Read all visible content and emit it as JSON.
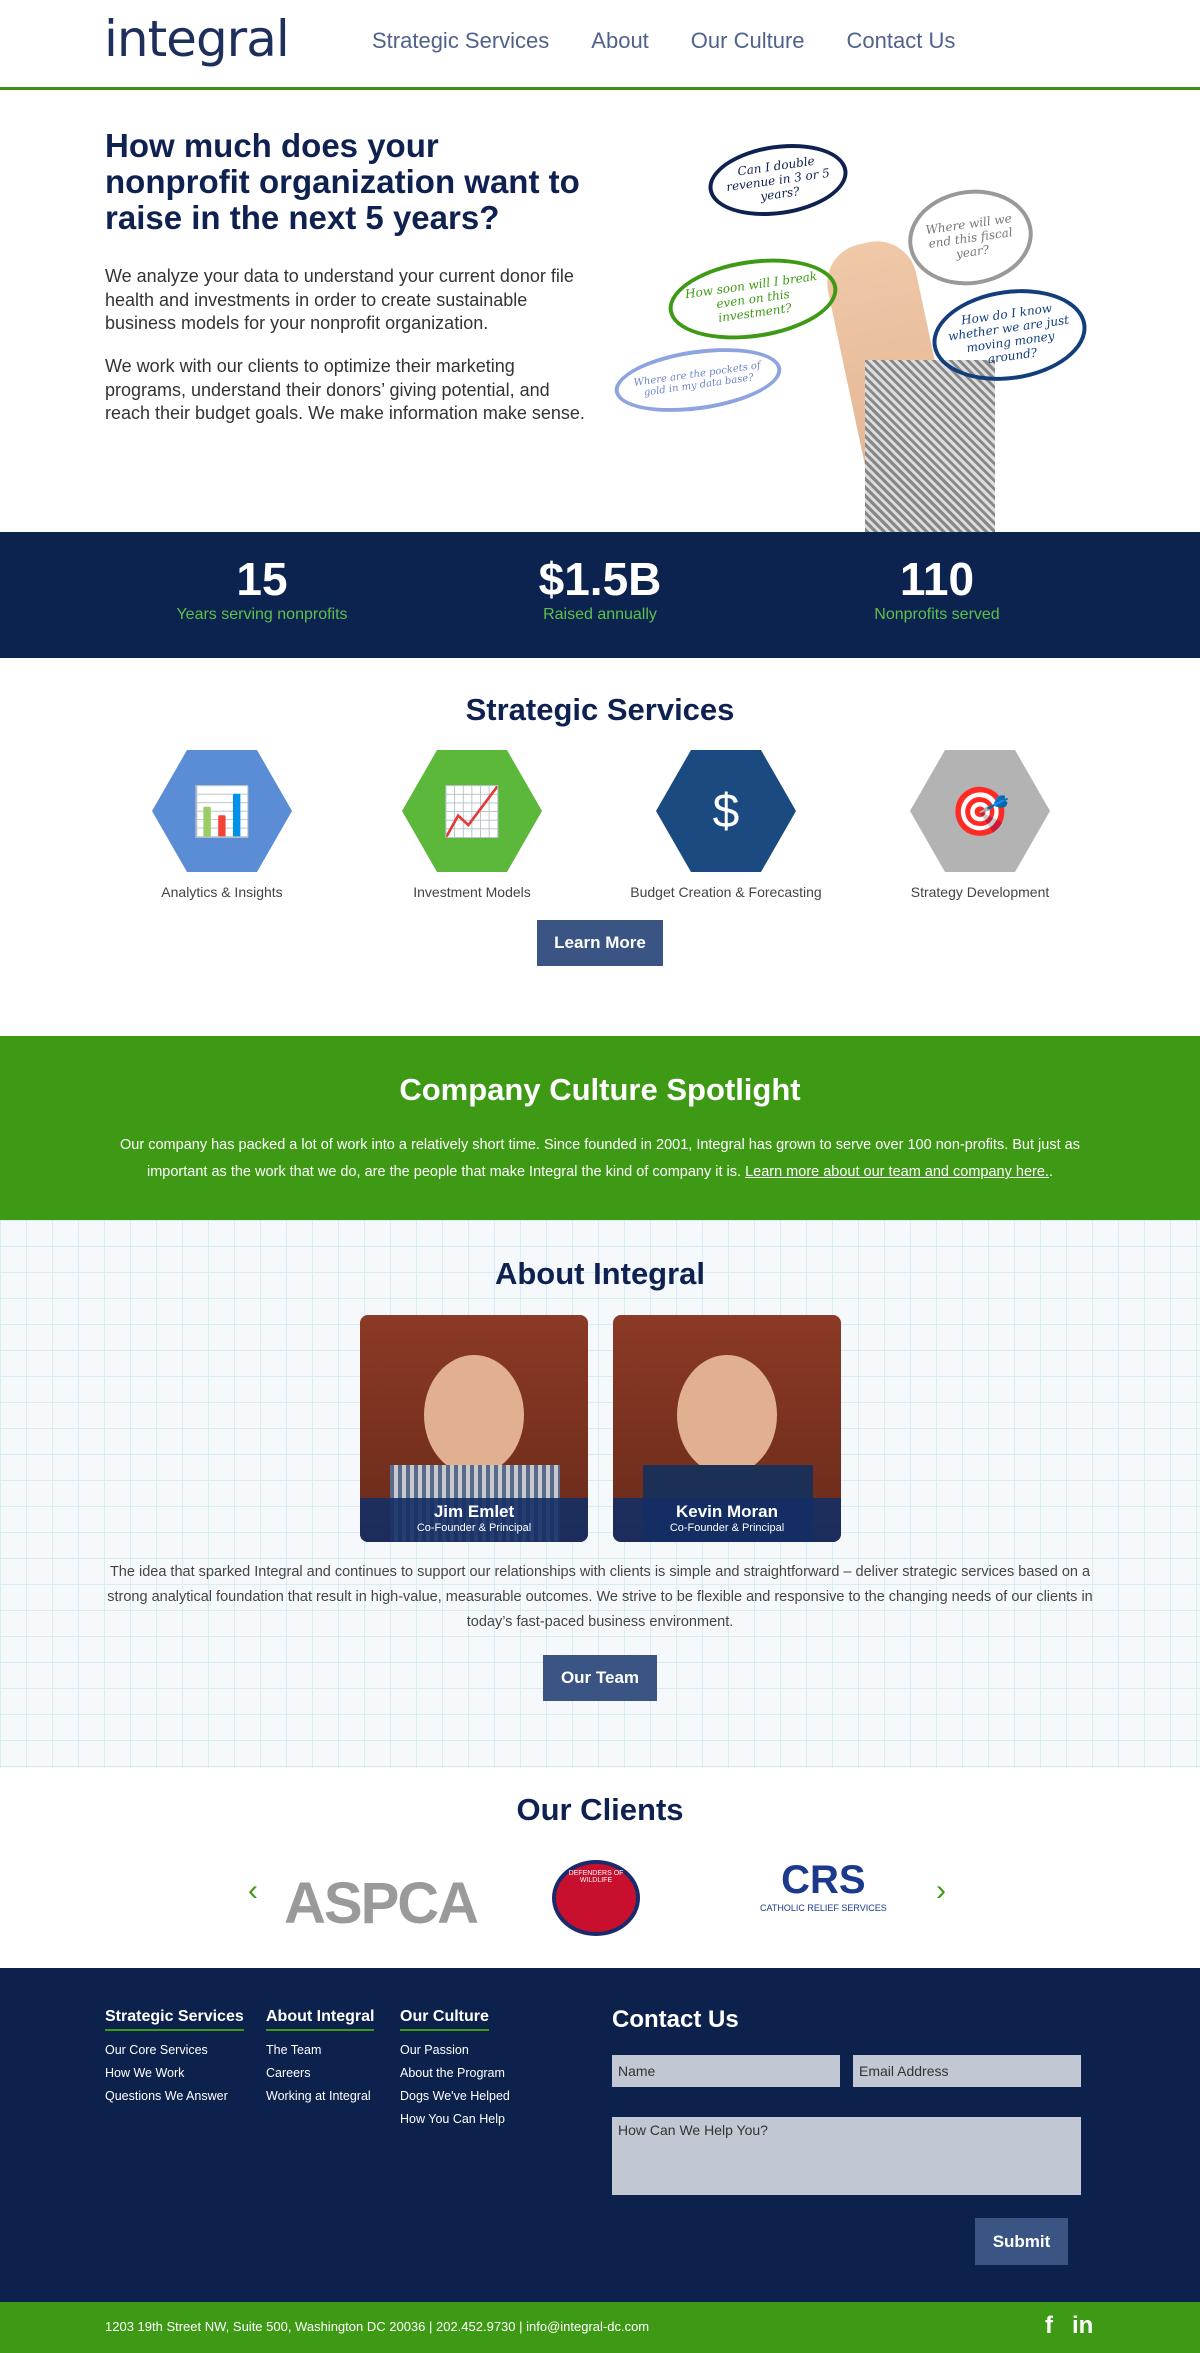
{
  "header": {
    "logo": "integral",
    "nav": [
      "Strategic Services",
      "About",
      "Our Culture",
      "Contact Us"
    ]
  },
  "hero": {
    "title": "How much does your nonprofit organization want to raise in the next 5 years?",
    "p1": "We analyze your data to understand your current donor file health and investments in order to create sustainable business models for your nonprofit organization.",
    "p2": "We work with our clients to optimize their marketing programs, understand their donors’ giving potential, and reach their budget goals. We make information make sense.",
    "bubbles": [
      "Can I double revenue in 3 or 5 years?",
      "Where will we end this fiscal year?",
      "How soon will I break even on this investment?",
      "How do I know whether we are just moving money around?",
      "Where are the pockets of gold in my data base?"
    ]
  },
  "stats": [
    {
      "n": "15",
      "l": "Years serving nonprofits"
    },
    {
      "n": "$1.5B",
      "l": "Raised annually"
    },
    {
      "n": "110",
      "l": "Nonprofits served"
    }
  ],
  "services": {
    "title": "Strategic Services",
    "items": [
      {
        "label": "Analytics & Insights",
        "color": "#5b8dd6"
      },
      {
        "label": "Investment Models",
        "color": "#5bb83a"
      },
      {
        "label": "Budget Creation & Forecasting",
        "color": "#1a4a80"
      },
      {
        "label": "Strategy Development",
        "color": "#b3b3b3"
      }
    ],
    "button": "Learn More"
  },
  "culture": {
    "title": "Company Culture Spotlight",
    "text": "Our company has packed a lot of work into a relatively short time. Since founded in 2001, Integral has grown to serve over 100 non-profits. But just as important as the work that we do, are the people that make Integral the kind of company it is. ",
    "link": "Learn more about our team and company here.",
    "after": "."
  },
  "about": {
    "title": "About Integral",
    "people": [
      {
        "name": "Jim Emlet",
        "title": "Co-Founder & Principal"
      },
      {
        "name": "Kevin Moran",
        "title": "Co-Founder & Principal"
      }
    ],
    "text": "The idea that sparked Integral and continues to support our relationships with clients is simple and straightforward – deliver strategic services based on a strong analytical foundation that result in high-value, measurable outcomes. We strive to be flexible and responsive to the changing needs of our clients in today’s fast-paced business environment.",
    "button": "Our Team"
  },
  "clients": {
    "title": "Our Clients",
    "logos": [
      "ASPCA",
      "DEFENDERS OF WILDLIFE",
      "CRS",
      "CATHOLIC RELIEF SERVICES"
    ]
  },
  "footer": {
    "cols": [
      {
        "title": "Strategic Services",
        "links": [
          "Our Core Services",
          "How We Work",
          "Questions We Answer"
        ]
      },
      {
        "title": "About Integral",
        "links": [
          "The Team",
          "Careers",
          "Working at Integral"
        ]
      },
      {
        "title": "Our Culture",
        "links": [
          "Our Passion",
          "About the Program",
          "Dogs We've Helped",
          "How You Can Help"
        ]
      }
    ],
    "contact": {
      "title": "Contact Us",
      "name_ph": "Name",
      "email_ph": "Email Address",
      "msg_ph": "How Can We Help You?",
      "submit": "Submit"
    }
  },
  "bottom": {
    "address": "1203 19th Street NW, Suite 500, Washington DC 20036 | 202.452.9730 | ",
    "email": "info@integral-dc.com",
    "social": [
      "f",
      "in"
    ]
  },
  "colors": {
    "navy": "#0c2350",
    "green": "#3e9a14",
    "button": "#3a5483"
  }
}
